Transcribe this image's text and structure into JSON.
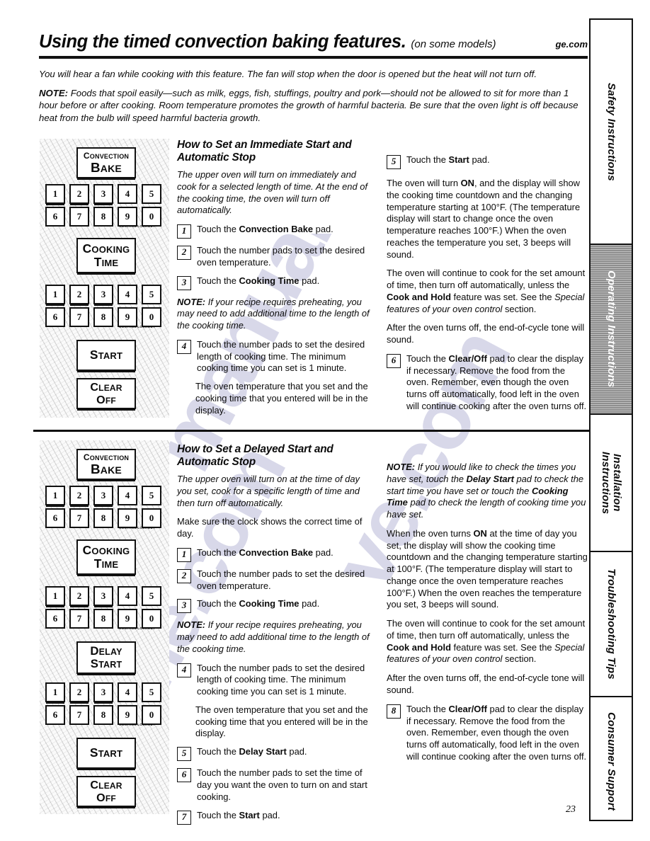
{
  "header": {
    "title": "Using the timed convection baking features.",
    "subtitle": "(on some models)",
    "site": "ge.com"
  },
  "intro": {
    "p1": "You will hear a fan while cooking with this feature. The fan will stop when the door is opened but the heat will not turn off.",
    "note_label": "NOTE:",
    "p2": " Foods that spoil easily—such as milk, eggs, fish, stuffings, poultry and pork—should not be allowed to sit for more than 1 hour before or after cooking. Room temperature promotes the growth of harmful bacteria. Be sure that the oven light is off because heat from the bulb will speed harmful bacteria growth."
  },
  "watermark": {
    "line1": "manualsl",
    "line2": "ve.com",
    "line3": "ine.com"
  },
  "control_panel": {
    "pads": {
      "convection_bake_1": "Convection",
      "convection_bake_2": "Bake",
      "cooking_time_1": "Cooking",
      "cooking_time_2": "Time",
      "delay_start_1": "Delay",
      "delay_start_2": "Start",
      "start": "Start",
      "clear_1": "Clear",
      "clear_2": "Off"
    },
    "keys_row1": [
      "1",
      "2",
      "3",
      "4",
      "5"
    ],
    "keys_row2": [
      "6",
      "7",
      "8",
      "9",
      "0"
    ],
    "lockout_label": "Control Lockout"
  },
  "section1": {
    "heading": "How to Set an Immediate Start and Automatic Stop",
    "intro": "The upper oven will turn on immediately and cook for a selected length of time. At the end of the cooking time, the oven will turn off automatically.",
    "steps": [
      {
        "n": "1",
        "pre": "Touch the ",
        "bold": "Convection Bake",
        "post": " pad."
      },
      {
        "n": "2",
        "pre": "Touch the number pads to set the desired oven temperature.",
        "bold": "",
        "post": ""
      },
      {
        "n": "3",
        "pre": "Touch the ",
        "bold": "Cooking Time",
        "post": " pad."
      },
      {
        "n": "4",
        "pre": "Touch the number pads to set the desired length of cooking time. The minimum cooking time you can set is 1 minute.",
        "bold": "",
        "post": ""
      },
      {
        "n": "5",
        "pre": "Touch the ",
        "bold": "Start",
        "post": " pad."
      },
      {
        "n": "6",
        "pre": "Touch the ",
        "bold": "Clear/Off",
        "post": " pad to clear the display if necessary. Remove the food from the oven. Remember, even though the oven turns off automatically, food left in the oven will continue cooking after the oven turns off."
      }
    ],
    "note_label": "NOTE:",
    "note": " If your recipe requires preheating, you may need to add additional time to the length of the cooking time.",
    "after_step4": "The oven temperature that you set and the cooking time that you entered will be in the display.",
    "p_on_1": "The oven will turn ",
    "p_on_bold": "ON",
    "p_on_2": ", and the display will show the cooking time countdown and the changing temperature starting at 100°F. (The temperature display will start to change once the oven temperature reaches 100°F.) When the oven reaches the temperature you set, 3 beeps will sound.",
    "p_cont_1": "The oven will continue to cook for the set amount of time, then turn off automatically, unless the ",
    "p_cont_bold": "Cook and Hold",
    "p_cont_2": " feature was set. See the ",
    "p_cont_ital": "Special features of your oven control",
    "p_cont_3": " section.",
    "p_tone": "After the oven turns off, the end-of-cycle tone will sound."
  },
  "section2": {
    "heading": "How to Set a Delayed Start and Automatic Stop",
    "intro": "The upper oven will turn on at the time of day you set, cook for a specific length of time and then turn off automatically.",
    "clock": "Make sure the clock shows the correct time of day.",
    "steps": [
      {
        "n": "1",
        "pre": "Touch the ",
        "bold": "Convection Bake",
        "post": " pad."
      },
      {
        "n": "2",
        "pre": "Touch the number pads to set the desired oven temperature.",
        "bold": "",
        "post": ""
      },
      {
        "n": "3",
        "pre": "Touch the ",
        "bold": "Cooking Time",
        "post": " pad."
      },
      {
        "n": "4",
        "pre": "Touch the number pads to set the desired length of cooking time. The minimum cooking time you can set is 1 minute.",
        "bold": "",
        "post": ""
      },
      {
        "n": "5",
        "pre": "Touch the ",
        "bold": "Delay Start",
        "post": " pad."
      },
      {
        "n": "6",
        "pre": "Touch the number pads to set the time of day you want the oven to turn on and start cooking.",
        "bold": "",
        "post": ""
      },
      {
        "n": "7",
        "pre": "Touch the ",
        "bold": "Start",
        "post": " pad."
      },
      {
        "n": "8",
        "pre": "Touch the ",
        "bold": "Clear/Off",
        "post": " pad to clear the display if necessary. Remove the food from the oven. Remember, even though the oven turns off automatically, food left in the oven will continue cooking after the oven turns off."
      }
    ],
    "note_label": "NOTE:",
    "note": " If your recipe requires preheating, you may need to add additional time to the length of the cooking time.",
    "after_step4": "The oven temperature that you set and the cooking time that you entered will be in the display.",
    "note2_label": "NOTE:",
    "note2_a": " If you would like to check the times you have set, touch the ",
    "note2_b": "Delay Start",
    "note2_c": " pad to check the start time you have set or touch the ",
    "note2_d": "Cooking Time",
    "note2_e": " pad to check the length of cooking time you have set.",
    "p_on_1": "When the oven turns ",
    "p_on_bold": "ON",
    "p_on_2": " at the time of day you set, the display will show the cooking time countdown and the changing temperature starting at 100°F. (The temperature display will start to change once the oven temperature reaches 100°F.) When the oven reaches the temperature you set, 3 beeps will sound.",
    "p_cont_1": "The oven will continue to cook for the set amount of time, then turn off automatically, unless the ",
    "p_cont_bold": "Cook and Hold",
    "p_cont_2": " feature was set. See the ",
    "p_cont_ital": "Special features of your oven control",
    "p_cont_3": " section.",
    "p_tone": "After the oven turns off, the end-of-cycle tone will sound."
  },
  "rail": {
    "tabs": [
      {
        "label": "Safety Instructions",
        "active": false
      },
      {
        "label": "Operating Instructions",
        "active": true
      },
      {
        "label": "Installation\nInstructions",
        "active": false
      },
      {
        "label": "Troubleshooting Tips",
        "active": false
      },
      {
        "label": "Consumer Support",
        "active": false
      }
    ]
  },
  "page_number": "23"
}
